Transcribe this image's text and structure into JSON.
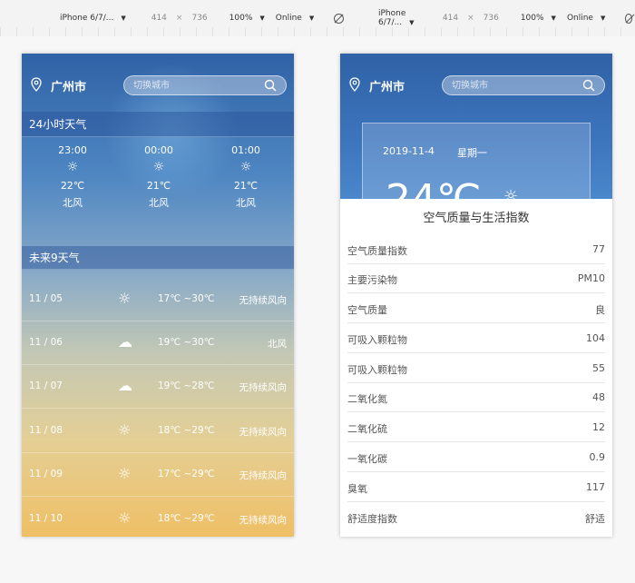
{
  "devtools": [
    {
      "device": "iPhone 6/7/...",
      "width": "414",
      "times": "×",
      "height": "736",
      "zoom": "100%",
      "network": "Online"
    },
    {
      "device": "iPhone 6/7/...",
      "width": "414",
      "times": "×",
      "height": "736",
      "zoom": "100%",
      "network": "Online"
    }
  ],
  "phone1": {
    "city": "广州市",
    "search_placeholder": "切换城市",
    "hourly_title": "24小时天气",
    "hourly": [
      {
        "time": "23:00",
        "icon": "sun-icon",
        "temp": "22℃",
        "wind": "北风"
      },
      {
        "time": "00:00",
        "icon": "sun-icon",
        "temp": "21℃",
        "wind": "北风"
      },
      {
        "time": "01:00",
        "icon": "sun-icon",
        "temp": "21℃",
        "wind": "北风"
      }
    ],
    "daily_title": "未来9天气",
    "daily": [
      {
        "date": "11 / 05",
        "icon": "sun-icon",
        "range": "17℃ ~30℃",
        "wind": "无持续风向"
      },
      {
        "date": "11 / 06",
        "icon": "cloudy-icon",
        "range": "19℃ ~30℃",
        "wind": "北风"
      },
      {
        "date": "11 / 07",
        "icon": "cloudy-icon",
        "range": "19℃ ~28℃",
        "wind": "无持续风向"
      },
      {
        "date": "11 / 08",
        "icon": "sun-icon",
        "range": "18℃ ~29℃",
        "wind": "无持续风向"
      },
      {
        "date": "11 / 09",
        "icon": "sun-icon",
        "range": "17℃ ~29℃",
        "wind": "无持续风向"
      },
      {
        "date": "11 / 10",
        "icon": "sun-icon",
        "range": "18℃ ~29℃",
        "wind": "无持续风向"
      }
    ]
  },
  "phone2": {
    "city": "广州市",
    "search_placeholder": "切换城市",
    "date": "2019-11-4",
    "weekday": "星期一",
    "big_temp": "24℃",
    "sheet_title": "空气质量与生活指数",
    "rows": [
      {
        "label": "空气质量指数",
        "value": "77"
      },
      {
        "label": "主要污染物",
        "value": "PM10"
      },
      {
        "label": "空气质量",
        "value": "良"
      },
      {
        "label": "可吸入颗粒物",
        "value": "104"
      },
      {
        "label": "可吸入颗粒物",
        "value": "55"
      },
      {
        "label": "二氧化氮",
        "value": "48"
      },
      {
        "label": "二氧化硫",
        "value": "12"
      },
      {
        "label": "一氧化碳",
        "value": "0.9"
      },
      {
        "label": "臭氧",
        "value": "117"
      },
      {
        "label": "舒适度指数",
        "value": "舒适"
      }
    ]
  }
}
